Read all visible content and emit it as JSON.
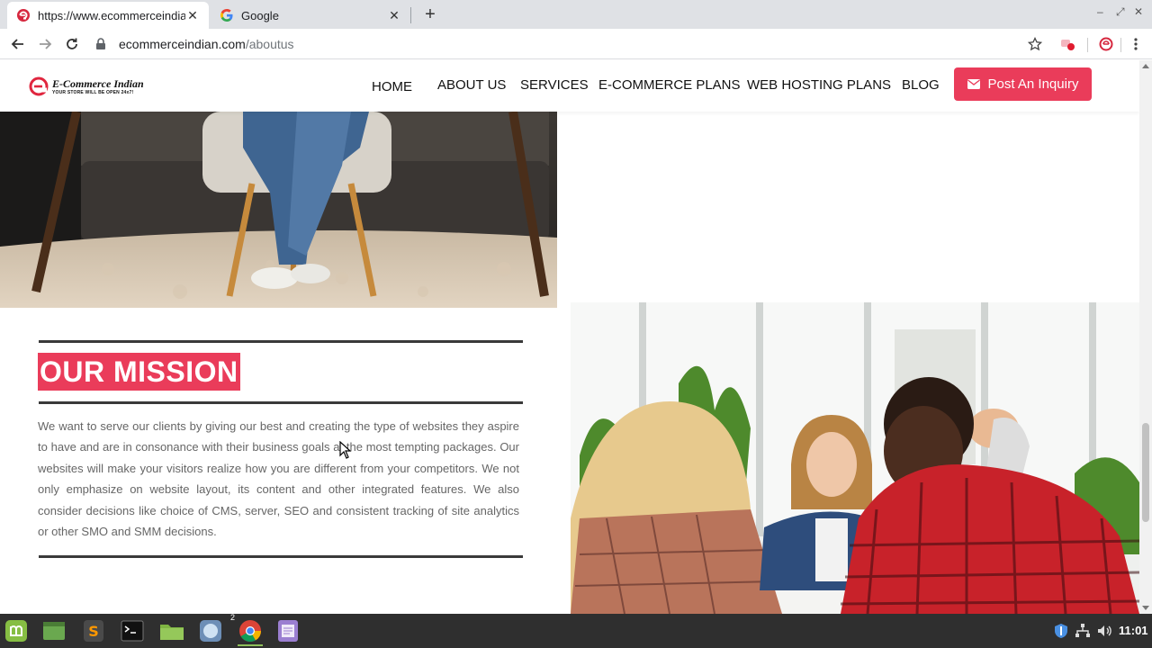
{
  "browser": {
    "tabs": [
      {
        "title": "https://www.ecommerceindian.",
        "active": true
      },
      {
        "title": "Google",
        "active": false
      }
    ],
    "url_host": "ecommerceindian.com",
    "url_path": "/aboutus"
  },
  "site": {
    "logo_name": "E-Commerce Indian",
    "logo_tagline": "YOUR STORE WILL BE OPEN 24x7!",
    "nav": [
      "HOME",
      "ABOUT US",
      "SERVICES",
      "E-COMMERCE PLANS",
      "WEB HOSTING PLANS",
      "BLOG"
    ],
    "cta_label": "Post An Inquiry",
    "accent_color": "#ea3c5a"
  },
  "mission": {
    "title": "OUR MISSION",
    "body": "We want to serve our clients by giving our best and creating the type of websites they aspire to have and are in consonance with their business goals at the most tempting packages. Our websites will make your visitors realize how you are different from your competitors. We not only emphasize on website layout, its content and other integrated features. We also consider decisions like choice of CMS, server, SEO and consistent tracking of site analytics or other SMO and SMM decisions."
  },
  "taskbar": {
    "apps": [
      "mint-menu-icon",
      "desktop-icon",
      "sublime-text-icon",
      "terminal-icon",
      "files-icon",
      "browser-icon",
      "chrome-icon",
      "text-editor-icon"
    ],
    "chrome_window_count": "2",
    "clock": "11:01"
  }
}
